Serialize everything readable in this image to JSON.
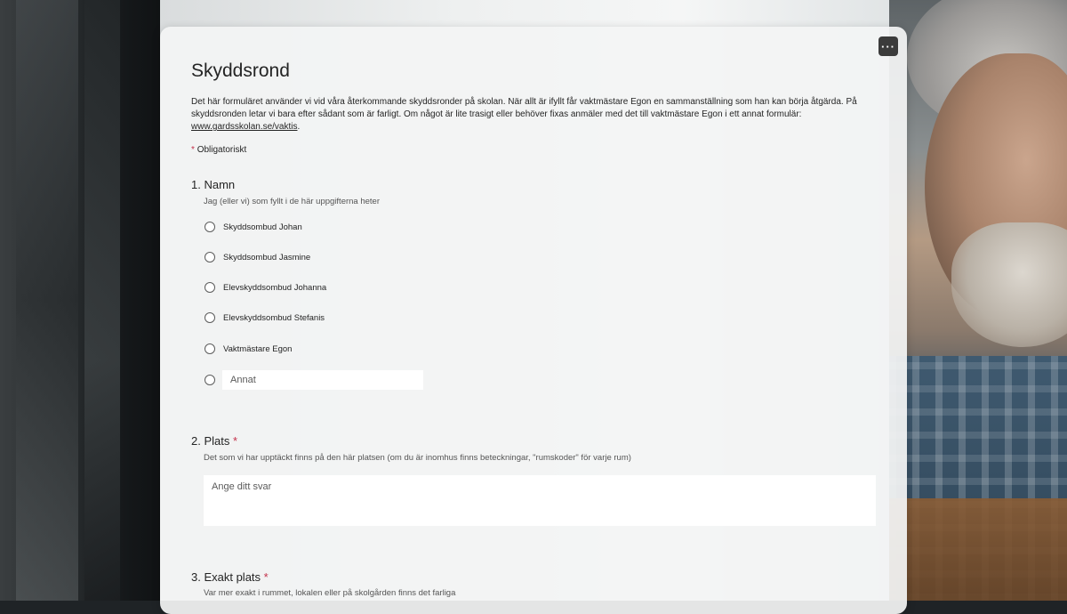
{
  "form": {
    "title": "Skyddsrond",
    "description_text": "Det här formuläret använder vi vid våra återkommande skyddsronder på skolan. När allt är ifyllt får vaktmästare Egon en sammanställning som han kan börja åtgärda. På skyddsronden letar vi bara efter sådant som är farligt. Om något är lite trasigt eller behöver fixas anmäler med det till vaktmästare Egon i ett annat formulär: ",
    "description_link": "www.gardsskolan.se/vaktis",
    "description_end": ".",
    "required_star": "*",
    "required_label": "Obligatoriskt",
    "more_label": "···"
  },
  "questions": [
    {
      "number_title": "1. Namn",
      "subtitle": "Jag (eller vi) som fyllt i de här uppgifterna heter",
      "options": [
        "Skyddsombud Johan",
        "Skyddsombud Jasmine",
        "Elevskyddsombud Johanna",
        "Elevskyddsombud Stefanis",
        "Vaktmästare Egon"
      ],
      "other_placeholder": "Annat"
    },
    {
      "number_title": "2. Plats",
      "required_star": "*",
      "subtitle": "Det som vi har upptäckt finns på den här platsen (om du är inomhus finns beteckningar, \"rumskoder\" för varje rum)",
      "answer_placeholder": "Ange ditt svar"
    },
    {
      "number_title": "3. Exakt plats",
      "required_star": "*",
      "subtitle": "Var mer exakt i rummet, lokalen eller på skolgården finns det farliga"
    }
  ],
  "colors": {
    "required": "#c4314b",
    "card": "#f3f4f4",
    "text": "#242424"
  }
}
